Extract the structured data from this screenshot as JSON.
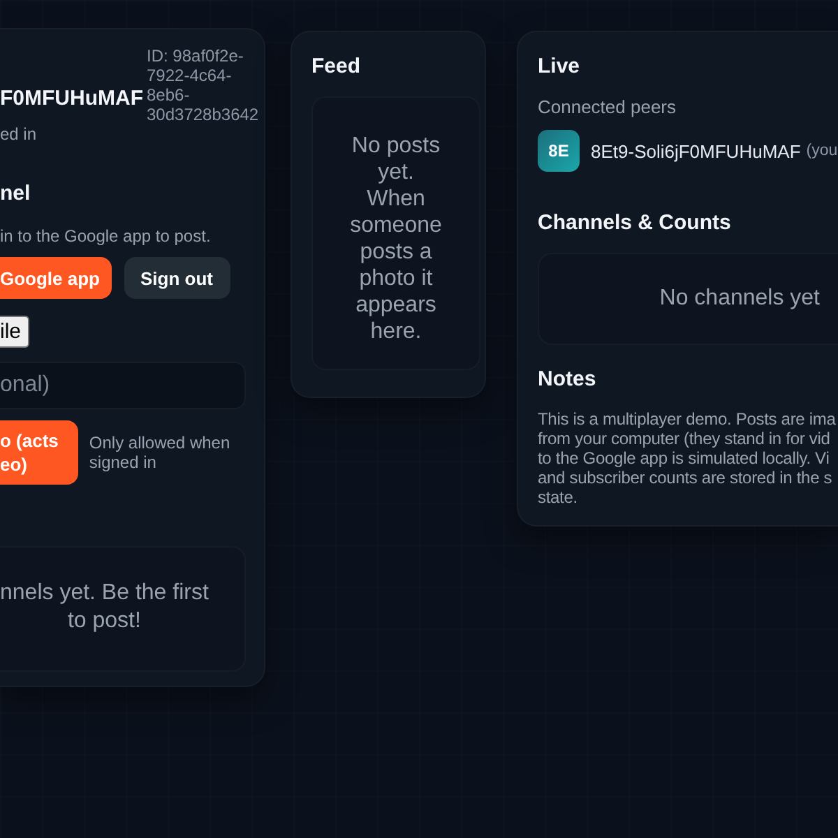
{
  "profile": {
    "name": "F0MFUHuMAF",
    "status": "ed in",
    "id": "ID: 98af0f2e-7922-4c64-8eb6-30d3728b3642"
  },
  "channel": {
    "title": "nel",
    "hint": "in to the Google app to post.",
    "buttons": [
      {
        "label": "Google app",
        "kind": "primary"
      },
      {
        "label": "Sign out",
        "kind": "secondary"
      }
    ],
    "file_button": "ile",
    "caption": {
      "placeholder": "onal)"
    },
    "upload": {
      "lines": [
        "o (acts",
        "eo)"
      ],
      "note": "Only allowed when signed in"
    },
    "empty": {
      "lines": [
        "nnels yet. Be the first",
        "to post!"
      ]
    }
  },
  "feed": {
    "title": "Feed",
    "empty": "No posts yet. When someone posts a photo it appears here."
  },
  "live": {
    "title": "Live",
    "peers_label": "Connected peers",
    "peers": [
      {
        "initials": "8E",
        "name": "8Et9-Soli6jF0MFUHuMAF",
        "tag": "(you"
      }
    ],
    "channels": {
      "title": "Channels & Counts",
      "empty": "No channels yet"
    },
    "notes": {
      "title": "Notes",
      "lines": [
        "This is a multiplayer demo. Posts are ima",
        "from your computer (they stand in for vid",
        "to the Google app is simulated locally. Vi",
        "and subscriber counts are stored in the s",
        "state."
      ]
    }
  }
}
